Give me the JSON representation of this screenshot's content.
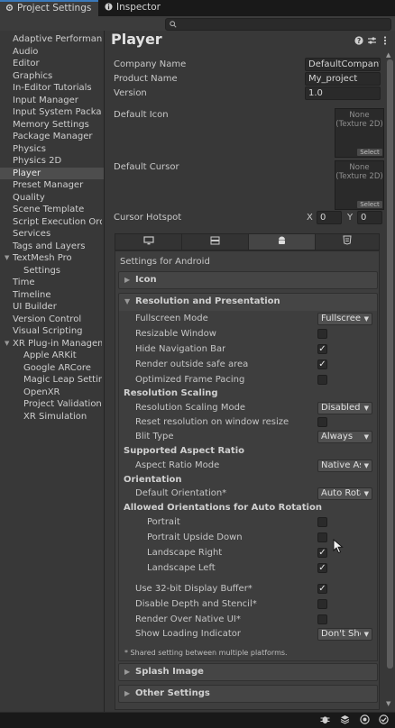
{
  "tabs": [
    {
      "label": "Project Settings",
      "icon": "gear-icon",
      "active": true
    },
    {
      "label": "Inspector",
      "icon": "info-icon",
      "active": false
    }
  ],
  "search": {
    "placeholder": ""
  },
  "sidebar": {
    "items": [
      {
        "label": "Adaptive Performance"
      },
      {
        "label": "Audio"
      },
      {
        "label": "Editor"
      },
      {
        "label": "Graphics"
      },
      {
        "label": "In-Editor Tutorials"
      },
      {
        "label": "Input Manager"
      },
      {
        "label": "Input System Package"
      },
      {
        "label": "Memory Settings"
      },
      {
        "label": "Package Manager"
      },
      {
        "label": "Physics"
      },
      {
        "label": "Physics 2D"
      },
      {
        "label": "Player",
        "selected": true
      },
      {
        "label": "Preset Manager"
      },
      {
        "label": "Quality"
      },
      {
        "label": "Scene Template"
      },
      {
        "label": "Script Execution Order"
      },
      {
        "label": "Services"
      },
      {
        "label": "Tags and Layers"
      },
      {
        "label": "TextMesh Pro",
        "expanded": true
      },
      {
        "label": "Settings",
        "child": true
      },
      {
        "label": "Time"
      },
      {
        "label": "Timeline"
      },
      {
        "label": "UI Builder"
      },
      {
        "label": "Version Control"
      },
      {
        "label": "Visual Scripting"
      },
      {
        "label": "XR Plug-in Management",
        "expanded": true
      },
      {
        "label": "Apple ARKit",
        "child": true
      },
      {
        "label": "Google ARCore",
        "child": true
      },
      {
        "label": "Magic Leap Settings",
        "child": true
      },
      {
        "label": "OpenXR",
        "child": true
      },
      {
        "label": "Project Validation",
        "child": true
      },
      {
        "label": "XR Simulation",
        "child": true
      }
    ]
  },
  "main": {
    "title": "Player",
    "header_icons": [
      "help-icon",
      "preset-icon",
      "more-icon"
    ],
    "company_label": "Company Name",
    "company_value": "DefaultCompany",
    "product_label": "Product Name",
    "product_value": "My_project",
    "version_label": "Version",
    "version_value": "1.0",
    "default_icon_label": "Default Icon",
    "default_cursor_label": "Default Cursor",
    "slot_text": "None\n(Texture 2D)",
    "slot_button": "Select",
    "hotspot_label": "Cursor Hotspot",
    "hotspot_x_label": "X",
    "hotspot_x": "0",
    "hotspot_y_label": "Y",
    "hotspot_y": "0",
    "platform_tabs": [
      {
        "icon": "monitor-icon",
        "active": false
      },
      {
        "icon": "server-icon",
        "active": false
      },
      {
        "icon": "android-icon",
        "active": true
      },
      {
        "icon": "html5-icon",
        "active": false
      }
    ],
    "settings_for": "Settings for Android",
    "icon_section": "Icon",
    "resolution_section": "Resolution and Presentation",
    "splash_section": "Splash Image",
    "other_section": "Other Settings",
    "rows": {
      "fullscreen_label": "Fullscreen Mode",
      "fullscreen_value": "Fullscreen Window",
      "resizable_label": "Resizable Window",
      "resizable_checked": false,
      "hide_nav_label": "Hide Navigation Bar",
      "hide_nav_checked": true,
      "safe_area_label": "Render outside safe area",
      "safe_area_checked": true,
      "frame_pacing_label": "Optimized Frame Pacing",
      "frame_pacing_checked": false,
      "scaling_header": "Resolution Scaling",
      "scaling_mode_label": "Resolution Scaling Mode",
      "scaling_mode_value": "Disabled",
      "reset_label": "Reset resolution on window resize",
      "reset_checked": false,
      "blit_label": "Blit Type",
      "blit_value": "Always",
      "aspect_header": "Supported Aspect Ratio",
      "aspect_label": "Aspect Ratio Mode",
      "aspect_value": "Native Aspect Ratio",
      "orientation_header": "Orientation",
      "default_orient_label": "Default Orientation*",
      "default_orient_value": "Auto Rotation",
      "allowed_header": "Allowed Orientations for Auto Rotation",
      "portrait_label": "Portrait",
      "portrait_checked": false,
      "portrait_ud_label": "Portrait Upside Down",
      "portrait_ud_checked": false,
      "land_right_label": "Landscape Right",
      "land_right_checked": true,
      "land_left_label": "Landscape Left",
      "land_left_checked": true,
      "buffer_label": "Use 32-bit Display Buffer*",
      "buffer_checked": true,
      "depth_label": "Disable Depth and Stencil*",
      "depth_checked": false,
      "native_ui_label": "Render Over Native UI*",
      "native_ui_checked": false,
      "loading_label": "Show Loading Indicator",
      "loading_value": "Don't Show"
    },
    "footnote": "* Shared setting between multiple platforms."
  },
  "statusbar": {
    "icons": [
      "bug-icon",
      "layers-icon",
      "record-icon",
      "check-circle-icon"
    ]
  },
  "colors": {
    "accent": "#3a79bb",
    "panel": "#383838",
    "background": "#282828",
    "selected": "#4d4d4d"
  }
}
